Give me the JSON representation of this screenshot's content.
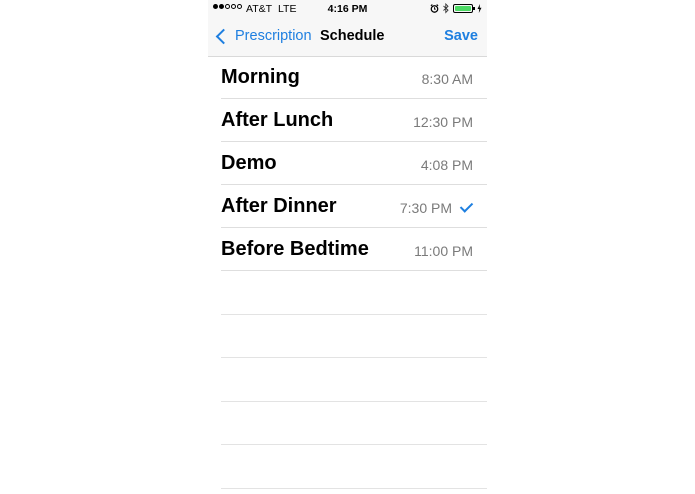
{
  "status_bar": {
    "carrier": "AT&T",
    "network": "LTE",
    "time": "4:16 PM",
    "signal_full_dots": 2,
    "signal_total_dots": 5,
    "battery_level": 1.0
  },
  "nav": {
    "back_label": "Prescription",
    "title": "Schedule",
    "save_label": "Save"
  },
  "schedule": [
    {
      "label": "Morning",
      "time": "8:30 AM",
      "checked": false
    },
    {
      "label": "After Lunch",
      "time": "12:30 PM",
      "checked": false
    },
    {
      "label": "Demo",
      "time": "4:08 PM",
      "checked": false
    },
    {
      "label": "After Dinner",
      "time": "7:30 PM",
      "checked": true
    },
    {
      "label": "Before Bedtime",
      "time": "11:00 PM",
      "checked": false
    }
  ],
  "colors": {
    "accent": "#1e7fe0",
    "battery": "#4cd964",
    "secondary_text": "#7a7a7a"
  }
}
